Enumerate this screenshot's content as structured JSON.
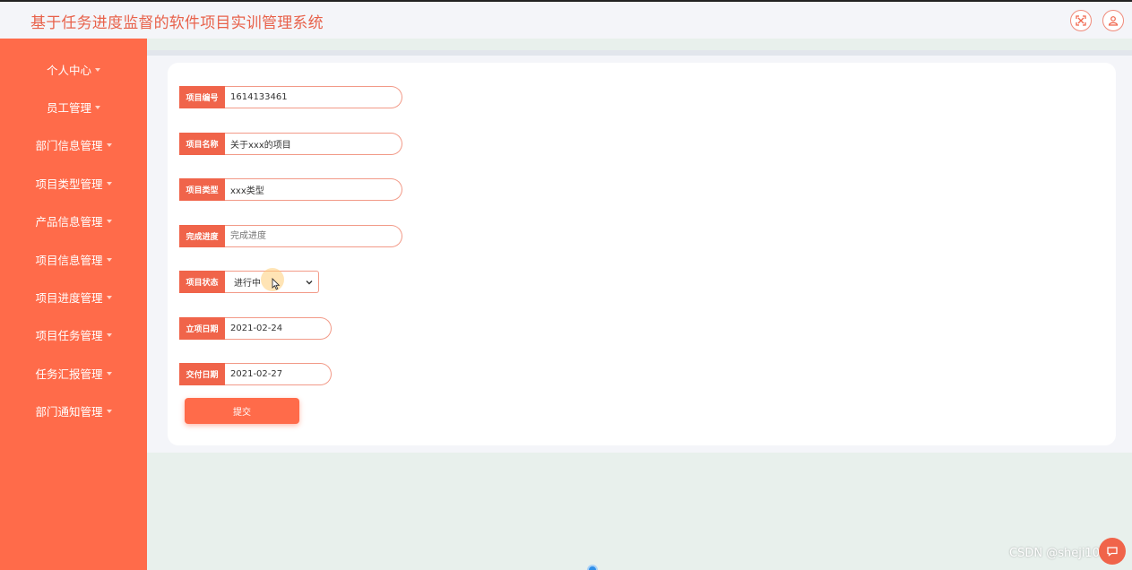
{
  "app": {
    "title": "基于任务进度监督的软件项目实训管理系统"
  },
  "header": {
    "fullscreen_icon": "fullscreen-icon",
    "user_icon": "user-icon"
  },
  "sidebar": {
    "items": [
      {
        "label": "个人中心"
      },
      {
        "label": "员工管理"
      },
      {
        "label": "部门信息管理"
      },
      {
        "label": "项目类型管理"
      },
      {
        "label": "产品信息管理"
      },
      {
        "label": "项目信息管理"
      },
      {
        "label": "项目进度管理"
      },
      {
        "label": "项目任务管理"
      },
      {
        "label": "任务汇报管理"
      },
      {
        "label": "部门通知管理"
      }
    ]
  },
  "form": {
    "project_number": {
      "label": "项目编号",
      "value": "1614133461"
    },
    "project_name": {
      "label": "项目名称",
      "value": "关于xxx的项目"
    },
    "project_type": {
      "label": "项目类型",
      "value": "xxx类型"
    },
    "progress": {
      "label": "完成进度",
      "placeholder": "完成进度"
    },
    "status": {
      "label": "项目状态",
      "value": "进行中"
    },
    "start_date": {
      "label": "立项日期",
      "value": "2021-02-24"
    },
    "delivery_date": {
      "label": "交付日期",
      "value": "2021-02-27"
    },
    "submit_label": "提交"
  },
  "watermark": "CSDN @sheji101"
}
